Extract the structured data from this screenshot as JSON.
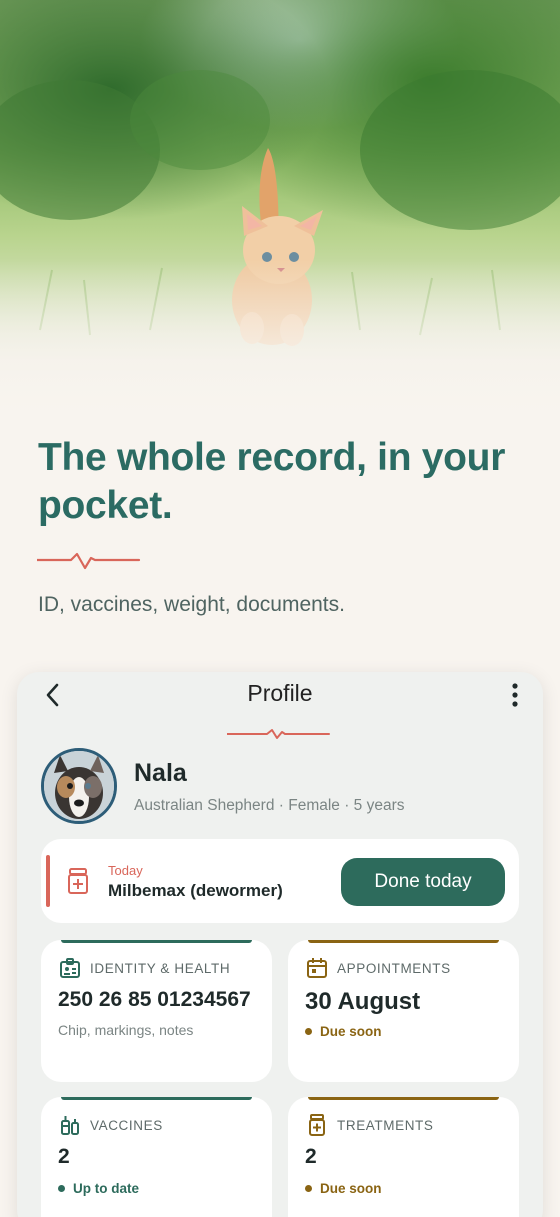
{
  "hero": {
    "headline": "The whole record, in your pocket.",
    "subtitle": "ID, vaccines, weight, documents."
  },
  "colors": {
    "brand_teal": "#2b6b63",
    "accent_coral": "#d9665a",
    "button_green": "#2d6b5c",
    "amber": "#8a6413"
  },
  "app": {
    "title": "Profile",
    "back_icon": "chevron-left-icon",
    "menu_icon": "more-vertical-icon",
    "pet": {
      "name": "Nala",
      "description": "Australian Shepherd · Female · 5 years"
    },
    "today_reminder": {
      "label": "Today",
      "medication": "Milbemax (dewormer)",
      "action_label": "Done today"
    },
    "tiles": [
      {
        "icon": "id-card-icon",
        "label": "IDENTITY & HEALTH",
        "value": "250 26 85 01234567",
        "subtext": "Chip, markings, notes",
        "accent": "#2d6b5c"
      },
      {
        "icon": "calendar-icon",
        "label": "APPOINTMENTS",
        "value": "30 August",
        "status": "Due soon",
        "accent": "#8a6413"
      },
      {
        "icon": "syringe-icon",
        "label": "VACCINES",
        "value": "2",
        "status": "Up to date",
        "accent": "#2d6b5c"
      },
      {
        "icon": "medicine-icon",
        "label": "TREATMENTS",
        "value": "2",
        "status": "Due soon",
        "accent": "#8a6413"
      }
    ]
  }
}
